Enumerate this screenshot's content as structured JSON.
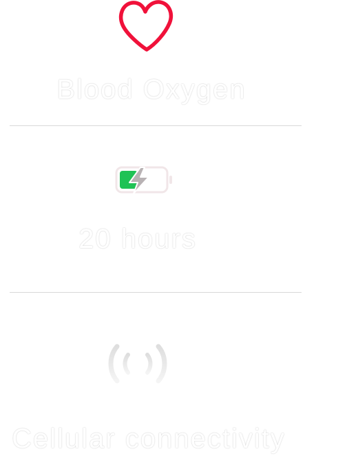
{
  "features": [
    {
      "label": "Blood Oxygen",
      "icon": "heart-icon"
    },
    {
      "label": "20 hours",
      "icon": "battery-charging-icon"
    },
    {
      "label": "Cellular connectivity",
      "icon": "cellular-signal-icon"
    }
  ],
  "colors": {
    "heart": "#f0113a",
    "battery_fill": "#1fc255",
    "bolt": "#b8b2b4",
    "signal": "#dcdcdc",
    "divider": "#d8d8d8"
  }
}
